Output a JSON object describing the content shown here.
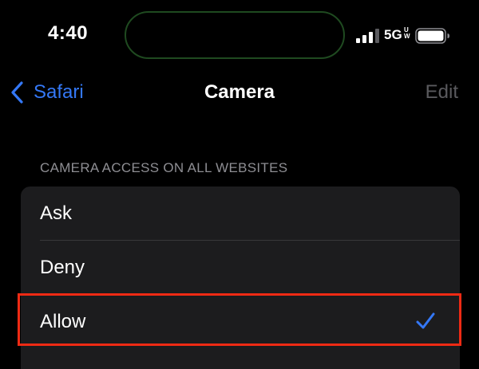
{
  "status_bar": {
    "time": "4:40",
    "network": "5G",
    "network_suffix": "UW",
    "signal_icon": "cellular-signal-icon",
    "battery_icon": "battery-icon"
  },
  "nav": {
    "back_label": "Safari",
    "title": "Camera",
    "edit_label": "Edit"
  },
  "section": {
    "header": "CAMERA ACCESS ON ALL WEBSITES",
    "options": [
      {
        "label": "Ask",
        "selected": false
      },
      {
        "label": "Deny",
        "selected": false
      },
      {
        "label": "Allow",
        "selected": true
      }
    ]
  },
  "colors": {
    "accent": "#3478f6",
    "background": "#000000",
    "cell": "#1c1c1e",
    "secondary_text": "#8e8e93",
    "disabled_text": "#5a5a5e",
    "highlight": "#ee2a14"
  }
}
